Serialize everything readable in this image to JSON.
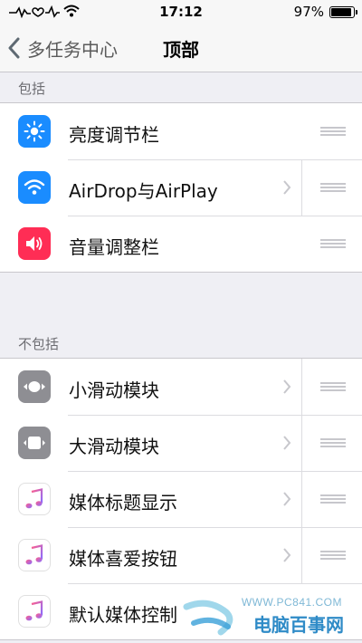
{
  "status_bar": {
    "time": "17:12",
    "battery_percent": "97%",
    "battery_level": 0.97
  },
  "nav": {
    "back_label": "多任务中心",
    "title": "顶部"
  },
  "sections": {
    "included": {
      "header": "包括",
      "items": [
        {
          "label": "亮度调节栏",
          "icon": "brightness-icon",
          "icon_color": "#1a8cff",
          "has_chevron": false
        },
        {
          "label": "AirDrop与AirPlay",
          "icon": "wifi-icon",
          "icon_color": "#1a8cff",
          "has_chevron": true
        },
        {
          "label": "音量调整栏",
          "icon": "volume-icon",
          "icon_color": "#ff2d55",
          "has_chevron": false
        }
      ]
    },
    "excluded": {
      "header": "不包括",
      "items": [
        {
          "label": "小滑动模块",
          "icon": "small-slider-icon",
          "icon_color": "#8e8e93",
          "has_chevron": true
        },
        {
          "label": "大滑动模块",
          "icon": "large-slider-icon",
          "icon_color": "#8e8e93",
          "has_chevron": true
        },
        {
          "label": "媒体标题显示",
          "icon": "music-note-icon",
          "icon_color": "#ffffff",
          "has_chevron": true
        },
        {
          "label": "媒体喜爱按钮",
          "icon": "music-note-icon",
          "icon_color": "#ffffff",
          "has_chevron": true
        },
        {
          "label": "默认媒体控制",
          "icon": "music-note-icon",
          "icon_color": "#ffffff",
          "has_chevron": false
        }
      ]
    }
  },
  "watermark": {
    "url": "WWW.PC841.COM",
    "brand": "电脑百事网"
  }
}
